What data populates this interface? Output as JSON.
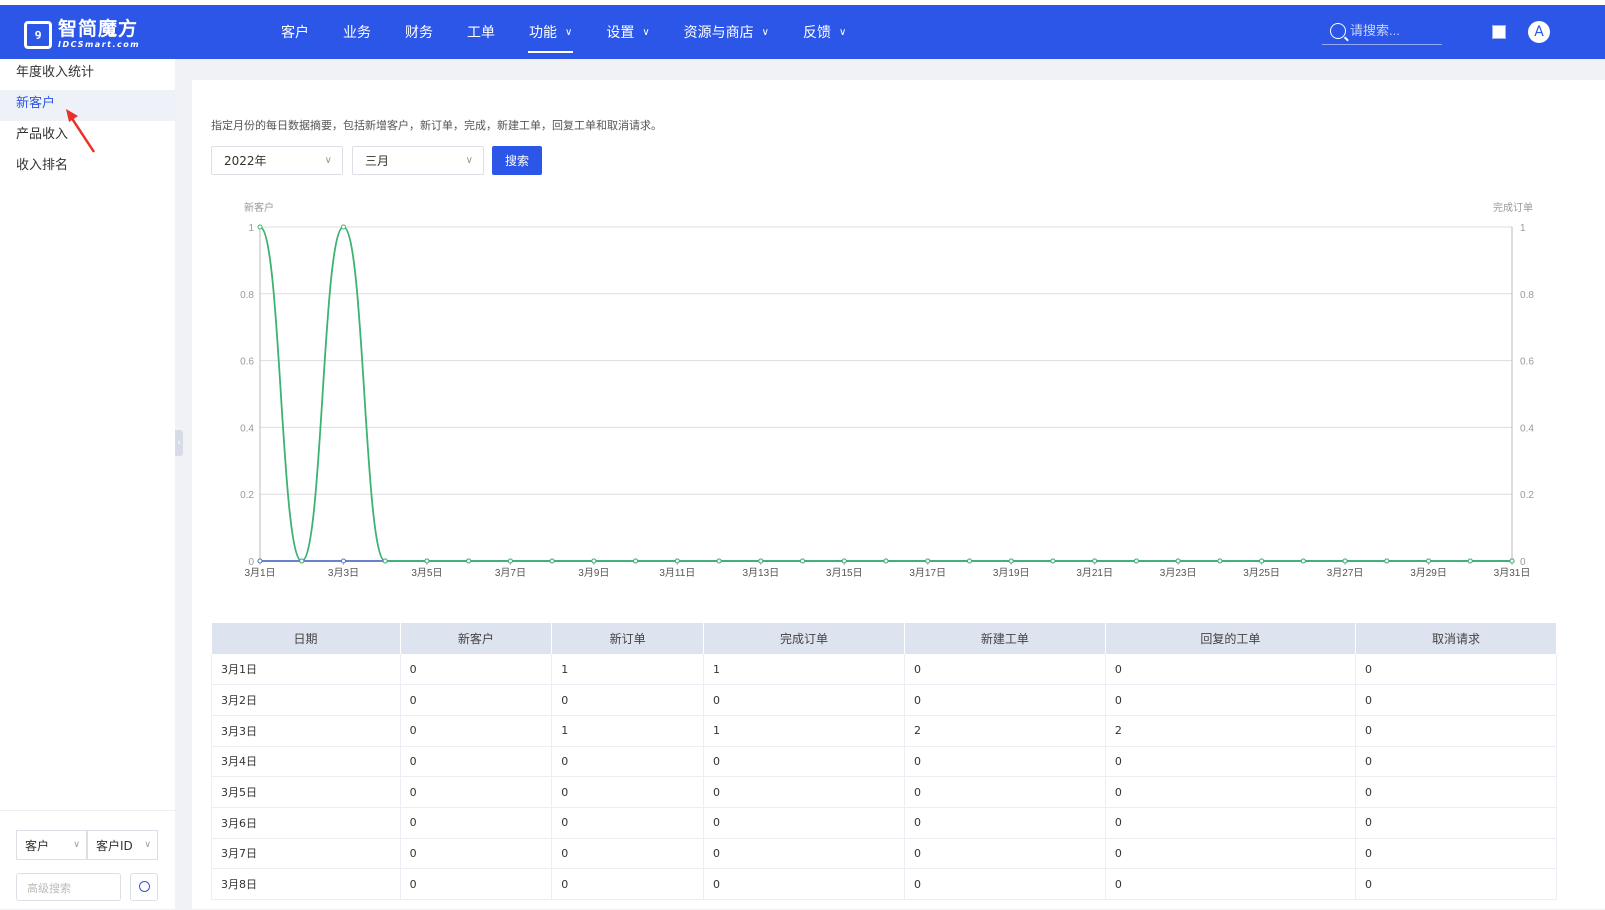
{
  "header": {
    "logo_cn": "智简魔方",
    "logo_en": "IDCSmart.com",
    "nav": [
      {
        "label": "客户",
        "dropdown": false,
        "active": false
      },
      {
        "label": "业务",
        "dropdown": false,
        "active": false
      },
      {
        "label": "财务",
        "dropdown": false,
        "active": false
      },
      {
        "label": "工单",
        "dropdown": false,
        "active": false
      },
      {
        "label": "功能",
        "dropdown": true,
        "active": true
      },
      {
        "label": "设置",
        "dropdown": true,
        "active": false
      },
      {
        "label": "资源与商店",
        "dropdown": true,
        "active": false
      },
      {
        "label": "反馈",
        "dropdown": true,
        "active": false
      }
    ],
    "search_placeholder": "请搜索...",
    "avatar_letter": "A",
    "brand_color": "#2b56e8"
  },
  "sidebar": {
    "items": [
      {
        "label": "年度收入统计",
        "active": false
      },
      {
        "label": "新客户",
        "active": true
      },
      {
        "label": "产品收入",
        "active": false
      },
      {
        "label": "收入排名",
        "active": false
      }
    ],
    "bottom": {
      "select1": "客户",
      "select2": "客户ID",
      "adv_placeholder": "高级搜索"
    }
  },
  "main": {
    "description": "指定月份的每日数据摘要，包括新增客户，新订单，完成，新建工单，回复工单和取消请求。",
    "year_select": "2022年",
    "month_select": "三月",
    "search_button": "搜索"
  },
  "chart_data": {
    "type": "line",
    "left_axis_label": "新客户",
    "right_axis_label": "完成订单",
    "ylim": [
      0,
      1
    ],
    "yticks": [
      "0",
      "0.2",
      "0.4",
      "0.6",
      "0.8",
      "1"
    ],
    "x": [
      "3月1日",
      "3月2日",
      "3月3日",
      "3月4日",
      "3月5日",
      "3月6日",
      "3月7日",
      "3月8日",
      "3月9日",
      "3月10日",
      "3月11日",
      "3月12日",
      "3月13日",
      "3月14日",
      "3月15日",
      "3月16日",
      "3月17日",
      "3月18日",
      "3月19日",
      "3月20日",
      "3月21日",
      "3月22日",
      "3月23日",
      "3月24日",
      "3月25日",
      "3月26日",
      "3月27日",
      "3月28日",
      "3月29日",
      "3月30日",
      "3月31日"
    ],
    "xtick_labels": [
      "3月1日",
      "3月3日",
      "3月5日",
      "3月7日",
      "3月9日",
      "3月11日",
      "3月13日",
      "3月15日",
      "3月17日",
      "3月19日",
      "3月21日",
      "3月23日",
      "3月25日",
      "3月27日",
      "3月29日",
      "3月31日"
    ],
    "series": [
      {
        "values": [
          0,
          0,
          0,
          0,
          0,
          0,
          0,
          0,
          0,
          0,
          0,
          0,
          0,
          0,
          0,
          0,
          0,
          0,
          0,
          0,
          0,
          0,
          0,
          0,
          0,
          0,
          0,
          0,
          0,
          0,
          0
        ],
        "color": "#5470c6"
      },
      {
        "values": [
          1,
          0,
          1,
          0,
          0,
          0,
          0,
          0,
          0,
          0,
          0,
          0,
          0,
          0,
          0,
          0,
          0,
          0,
          0,
          0,
          0,
          0,
          0,
          0,
          0,
          0,
          0,
          0,
          0,
          0,
          0
        ],
        "color": "#3cb371"
      }
    ]
  },
  "table": {
    "headers": [
      "日期",
      "新客户",
      "新订单",
      "完成订单",
      "新建工单",
      "回复的工单",
      "取消请求"
    ],
    "rows": [
      [
        "3月1日",
        "0",
        "1",
        "1",
        "0",
        "0",
        "0"
      ],
      [
        "3月2日",
        "0",
        "0",
        "0",
        "0",
        "0",
        "0"
      ],
      [
        "3月3日",
        "0",
        "1",
        "1",
        "2",
        "2",
        "0"
      ],
      [
        "3月4日",
        "0",
        "0",
        "0",
        "0",
        "0",
        "0"
      ],
      [
        "3月5日",
        "0",
        "0",
        "0",
        "0",
        "0",
        "0"
      ],
      [
        "3月6日",
        "0",
        "0",
        "0",
        "0",
        "0",
        "0"
      ],
      [
        "3月7日",
        "0",
        "0",
        "0",
        "0",
        "0",
        "0"
      ],
      [
        "3月8日",
        "0",
        "0",
        "0",
        "0",
        "0",
        "0"
      ]
    ]
  }
}
